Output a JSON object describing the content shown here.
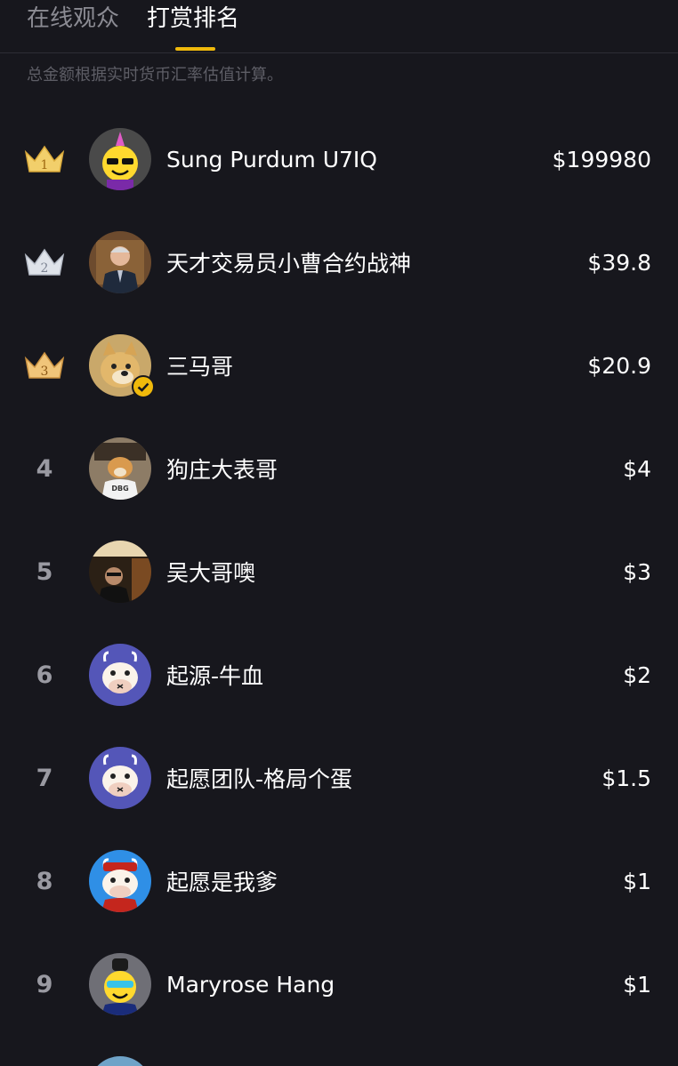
{
  "tabs": [
    {
      "label": "在线观众",
      "active": false
    },
    {
      "label": "打赏排名",
      "active": true
    }
  ],
  "accent_color": "#f0b90b",
  "note": "总金额根据实时货币汇率估值计算。",
  "rankings": [
    {
      "rank": "1",
      "badge": "gold-crown-icon",
      "avatar": "party-smiley-avatar",
      "name": "Sung Purdum U7IQ",
      "amount": "$199980"
    },
    {
      "rank": "2",
      "badge": "silver-crown-icon",
      "avatar": "suit-man-avatar",
      "name": "天才交易员小曹合约战神",
      "amount": "$39.8"
    },
    {
      "rank": "3",
      "badge": "bronze-crown-icon",
      "avatar": "doge-avatar",
      "name": "三马哥",
      "amount": "$20.9",
      "verified": true
    },
    {
      "rank": "4",
      "avatar": "shiba-dbg-avatar",
      "name": "狗庄大表哥",
      "amount": "$4"
    },
    {
      "rank": "5",
      "avatar": "man-with-sign-avatar",
      "name": "吴大哥噢",
      "amount": "$3"
    },
    {
      "rank": "6",
      "avatar": "cow-avatar",
      "name": "起源-牛血",
      "amount": "$2"
    },
    {
      "rank": "7",
      "avatar": "cow-avatar",
      "name": "起愿团队-格局个蛋",
      "amount": "$1.5"
    },
    {
      "rank": "8",
      "avatar": "cow-red-avatar",
      "name": "起愿是我爹",
      "amount": "$1"
    },
    {
      "rank": "9",
      "avatar": "smiley-sunglasses-avatar",
      "name": "Maryrose Hang",
      "amount": "$1"
    }
  ]
}
